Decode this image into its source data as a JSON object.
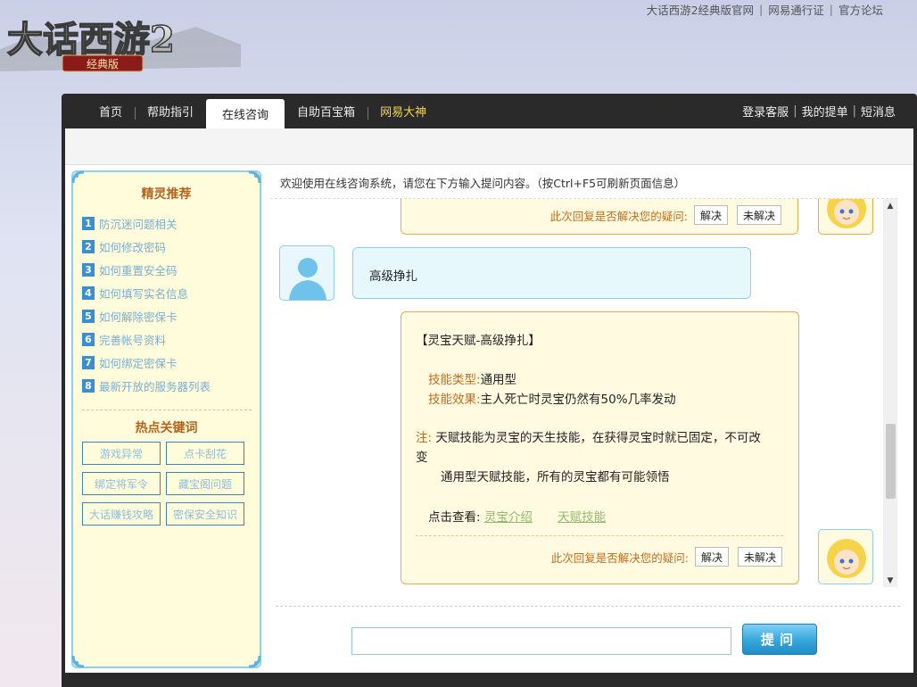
{
  "logo": {
    "title": "大话西游2",
    "subtitle": "经典版"
  },
  "top_links": [
    "大话西游2经典版官网",
    "网易通行证",
    "官方论坛"
  ],
  "nav": {
    "tabs": [
      {
        "label": "首页"
      },
      {
        "label": "帮助指引"
      },
      {
        "label": "在线咨询",
        "active": true
      },
      {
        "label": "自助百宝箱"
      },
      {
        "label": "网易大神",
        "highlight": true
      }
    ],
    "right_links": [
      "登录客服",
      "我的提单",
      "短消息"
    ]
  },
  "sidebar": {
    "recommend_title": "精灵推荐",
    "recommend": [
      {
        "num": "1",
        "label": "防沉迷问题相关"
      },
      {
        "num": "2",
        "label": "如何修改密码"
      },
      {
        "num": "3",
        "label": "如何重置安全码"
      },
      {
        "num": "4",
        "label": "如何填写实名信息"
      },
      {
        "num": "5",
        "label": "如何解除密保卡"
      },
      {
        "num": "6",
        "label": "完善帐号资料"
      },
      {
        "num": "7",
        "label": "如何绑定密保卡"
      },
      {
        "num": "8",
        "label": "最新开放的服务器列表"
      }
    ],
    "keywords_title": "热点关键词",
    "keywords": [
      "游戏异常",
      "点卡刮花",
      "绑定将军令",
      "藏宝阁问题",
      "大话赚钱攻略",
      "密保安全知识"
    ]
  },
  "chat": {
    "welcome": "欢迎使用在线咨询系统，请您在下方输入提问内容。（按Ctrl+F5可刷新页面信息）",
    "feedback_question": "此次回复是否解决您的疑问:",
    "btn_solved": "解决",
    "btn_unsolved": "未解决",
    "user_message": "高级挣扎",
    "bot_reply": {
      "heading": "【灵宝天赋-高级挣扎】",
      "type_label": "技能类型:",
      "type_value": "通用型",
      "effect_label": "技能效果:",
      "effect_value": "主人死亡时灵宝仍然有50%几率发动",
      "note_label": "注:",
      "note_line1": " 天赋技能为灵宝的天生技能，在获得灵宝时就已固定，不可改",
      "note_line1_wrap": "变",
      "note_line2": "通用型天赋技能，所有的灵宝都有可能领悟",
      "view_label": "点击查看:",
      "link1": "灵宝介绍",
      "link2": "天赋技能"
    }
  },
  "ask": {
    "input_value": "",
    "button": "提问"
  },
  "colors": {
    "accent": "#36a6db",
    "label_orange": "#c46d1b",
    "link_green": "#8fbc6c",
    "nav_highlight": "#f6d64a"
  }
}
